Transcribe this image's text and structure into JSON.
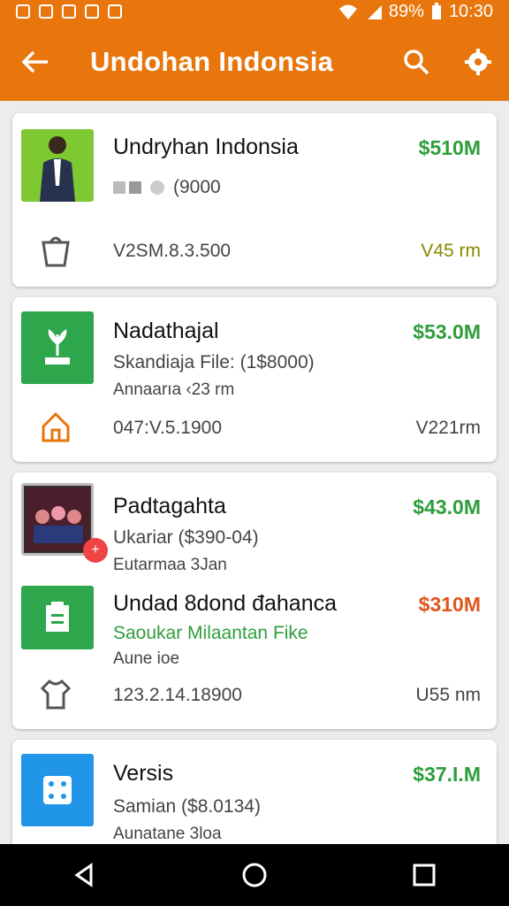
{
  "status": {
    "battery": "89%",
    "time": "10:30"
  },
  "appbar": {
    "title": "Undohan Indonsia"
  },
  "cards": [
    {
      "name": "Undryhan Indonsia",
      "price": "$510M",
      "sub": "(9000",
      "code": "V2SM.8.3.500",
      "dist": "V45 rm"
    },
    {
      "name": "Nadathajal",
      "price": "$53.0M",
      "sub": "Skandiaja File: (1$8000)",
      "sub2": "Annaarıa ‹23 rm",
      "code": "047:V.5.1900",
      "dist": "V221rm"
    },
    {
      "name": "Padtagahta",
      "price": "$43.0M",
      "sub": "Ukariar ($390-04)",
      "sub2": "Eutarmaa 3Jan",
      "name2": "Undad 8dond đahanca",
      "price2": "$310M",
      "sub3": "Saoukar Milaantan Fike",
      "sub4": "Aune ioe",
      "code": "123.2.14.18900",
      "dist": "U55 nm"
    },
    {
      "name": "Versis",
      "price": "$37.I.M",
      "sub": "Samian ($8.0134)",
      "sub2": "Aunatane 3loa"
    }
  ],
  "colors": {
    "brand": "#e8760c",
    "price_green": "#2e9e3a",
    "price_orange": "#e0561b"
  },
  "icons": [
    "back-arrow-icon",
    "search-icon",
    "settings-icon",
    "bag-icon",
    "home-icon",
    "shirt-icon",
    "clipboard-icon",
    "dice-icon"
  ]
}
